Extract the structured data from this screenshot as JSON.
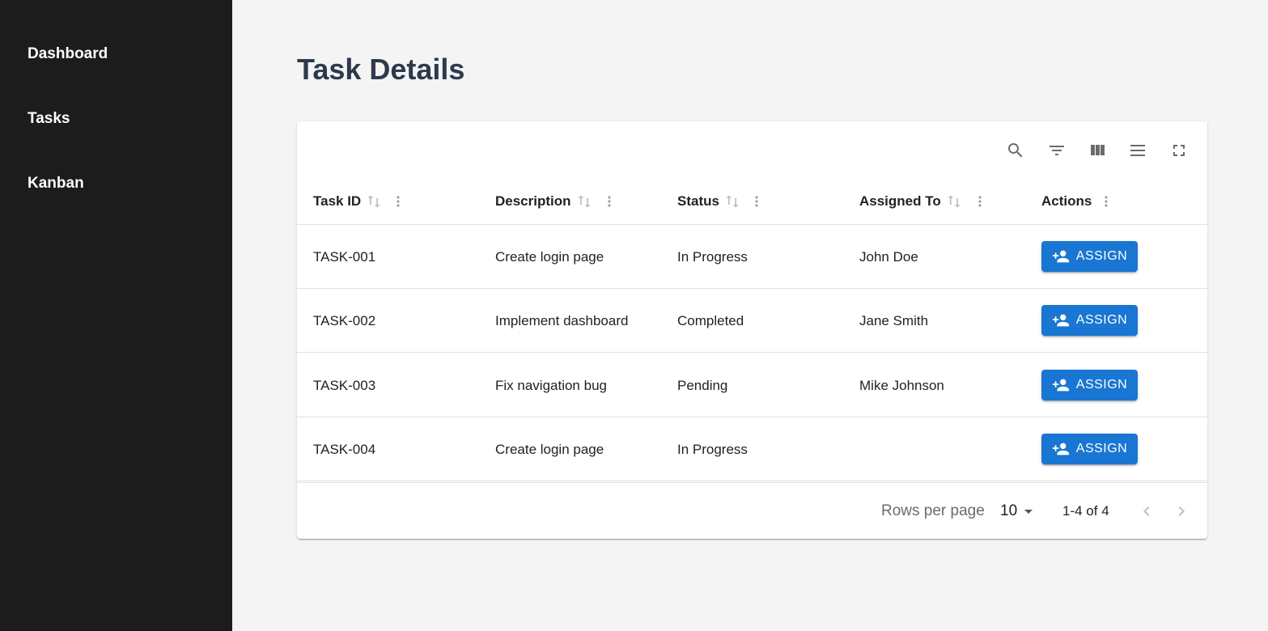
{
  "sidebar": {
    "items": [
      {
        "label": "Dashboard"
      },
      {
        "label": "Tasks"
      },
      {
        "label": "Kanban"
      }
    ]
  },
  "page": {
    "title": "Task Details"
  },
  "toolbar": {
    "icons": [
      "search-icon",
      "filter-icon",
      "columns-icon",
      "density-icon",
      "fullscreen-icon"
    ]
  },
  "table": {
    "columns": [
      "Task ID",
      "Description",
      "Status",
      "Assigned To",
      "Actions"
    ],
    "rows": [
      {
        "id": "TASK-001",
        "description": "Create login page",
        "status": "In Progress",
        "assigned": "John Doe",
        "action": "ASSIGN"
      },
      {
        "id": "TASK-002",
        "description": "Implement dashboard",
        "status": "Completed",
        "assigned": "Jane Smith",
        "action": "ASSIGN"
      },
      {
        "id": "TASK-003",
        "description": "Fix navigation bug",
        "status": "Pending",
        "assigned": "Mike Johnson",
        "action": "ASSIGN"
      },
      {
        "id": "TASK-004",
        "description": "Create login page",
        "status": "In Progress",
        "assigned": "",
        "action": "ASSIGN"
      }
    ]
  },
  "pagination": {
    "rows_per_page_label": "Rows per page",
    "rows_per_page_value": "10",
    "range": "1-4 of 4"
  },
  "colors": {
    "sidebar_bg": "#1c1c1c",
    "accent": "#1976d2",
    "title": "#2c3a4b"
  }
}
